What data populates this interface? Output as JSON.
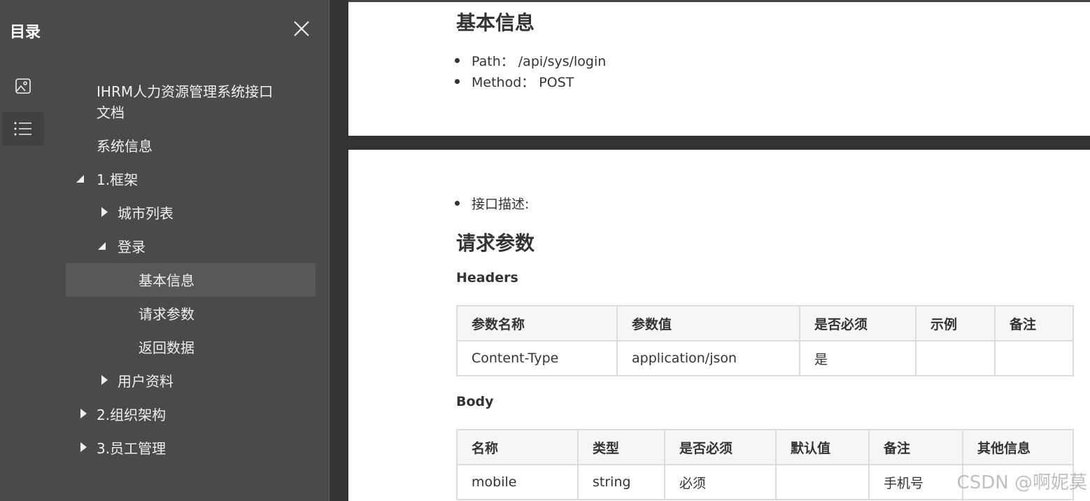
{
  "sidebar": {
    "title": "目录",
    "toc": [
      {
        "label": "IHRM人力资源管理系统接口",
        "label2": "文档"
      },
      {
        "label": "系统信息"
      },
      {
        "label": "1.框架"
      },
      {
        "label": "城市列表"
      },
      {
        "label": "登录"
      },
      {
        "label": "基本信息"
      },
      {
        "label": "请求参数"
      },
      {
        "label": "返回数据"
      },
      {
        "label": "用户资料"
      },
      {
        "label": "2.组织架构"
      },
      {
        "label": "3.员工管理"
      }
    ]
  },
  "content": {
    "basic_info": {
      "heading": "基本信息",
      "path": "Path： /api/sys/login",
      "method": "Method： POST"
    },
    "desc": "接口描述:",
    "params_heading": "请求参数",
    "headers_heading": "Headers",
    "headers_table": {
      "columns": [
        "参数名称",
        "参数值",
        "是否必须",
        "示例",
        "备注"
      ],
      "rows": [
        [
          "Content-Type",
          "application/json",
          "是",
          "",
          ""
        ]
      ]
    },
    "body_heading": "Body",
    "body_table": {
      "columns": [
        "名称",
        "类型",
        "是否必须",
        "默认值",
        "备注",
        "其他信息"
      ],
      "rows": [
        [
          "mobile",
          "string",
          "必须",
          "",
          "手机号",
          ""
        ]
      ]
    }
  },
  "watermark": "CSDN @啊妮莫"
}
